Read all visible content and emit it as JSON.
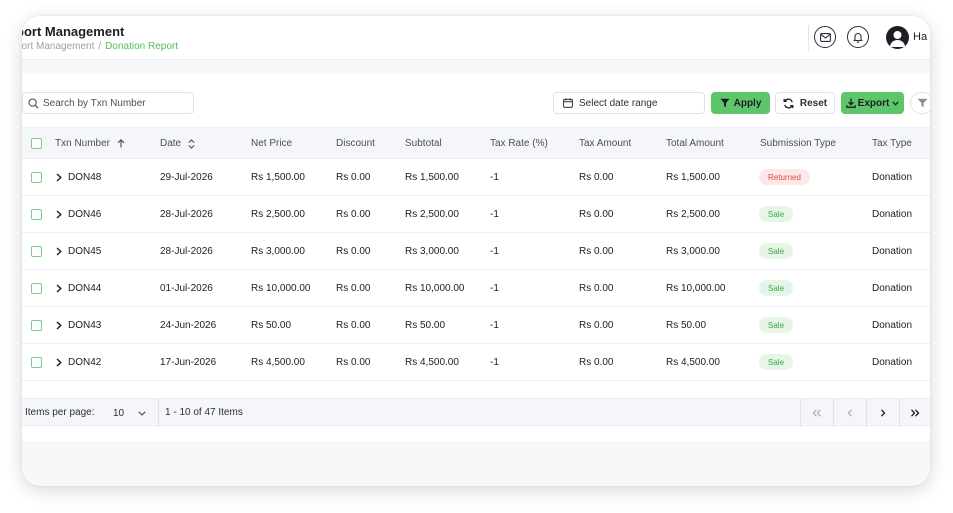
{
  "header": {
    "title": "port Management",
    "breadcrumb_parent": "port Management",
    "breadcrumb_separator": "/",
    "breadcrumb_current": "Donation Report",
    "user_name": "Ha"
  },
  "toolbar": {
    "search_placeholder": "Search by Txn Number",
    "date_range_placeholder": "Select date range",
    "apply_label": "Apply",
    "reset_label": "Reset",
    "export_label": "Export"
  },
  "table": {
    "columns": [
      "Txn Number",
      "Date",
      "Net Price",
      "Discount",
      "Subtotal",
      "Tax Rate (%)",
      "Tax Amount",
      "Total Amount",
      "Submission Type",
      "Tax Type"
    ],
    "rows": [
      {
        "txn": "DON48",
        "date": "29-Jul-2026",
        "net": "Rs 1,500.00",
        "discount": "Rs 0.00",
        "subtotal": "Rs 1,500.00",
        "tax_rate": "-1",
        "tax_amount": "Rs 0.00",
        "total": "Rs 1,500.00",
        "submission": "Returned",
        "tax_type": "Donation"
      },
      {
        "txn": "DON46",
        "date": "28-Jul-2026",
        "net": "Rs 2,500.00",
        "discount": "Rs 0.00",
        "subtotal": "Rs 2,500.00",
        "tax_rate": "-1",
        "tax_amount": "Rs 0.00",
        "total": "Rs 2,500.00",
        "submission": "Sale",
        "tax_type": "Donation"
      },
      {
        "txn": "DON45",
        "date": "28-Jul-2026",
        "net": "Rs 3,000.00",
        "discount": "Rs 0.00",
        "subtotal": "Rs 3,000.00",
        "tax_rate": "-1",
        "tax_amount": "Rs 0.00",
        "total": "Rs 3,000.00",
        "submission": "Sale",
        "tax_type": "Donation"
      },
      {
        "txn": "DON44",
        "date": "01-Jul-2026",
        "net": "Rs 10,000.00",
        "discount": "Rs 0.00",
        "subtotal": "Rs 10,000.00",
        "tax_rate": "-1",
        "tax_amount": "Rs 0.00",
        "total": "Rs 10,000.00",
        "submission": "Sale",
        "tax_type": "Donation"
      },
      {
        "txn": "DON43",
        "date": "24-Jun-2026",
        "net": "Rs 50.00",
        "discount": "Rs 0.00",
        "subtotal": "Rs 50.00",
        "tax_rate": "-1",
        "tax_amount": "Rs 0.00",
        "total": "Rs 50.00",
        "submission": "Sale",
        "tax_type": "Donation"
      },
      {
        "txn": "DON42",
        "date": "17-Jun-2026",
        "net": "Rs 4,500.00",
        "discount": "Rs 0.00",
        "subtotal": "Rs 4,500.00",
        "tax_rate": "-1",
        "tax_amount": "Rs 0.00",
        "total": "Rs 4,500.00",
        "submission": "Sale",
        "tax_type": "Donation"
      }
    ]
  },
  "footer": {
    "items_per_page_label": "Items per page:",
    "items_per_page_value": "10",
    "range_text": "1 - 10 of 47 Items"
  },
  "colors": {
    "accent": "#5ec66a",
    "breadcrumb_active": "#4fc25b",
    "returned_bg": "#fde8e8",
    "returned_text": "#d84b4b",
    "sale_bg": "#e5f6e7",
    "sale_text": "#3fa64b"
  }
}
